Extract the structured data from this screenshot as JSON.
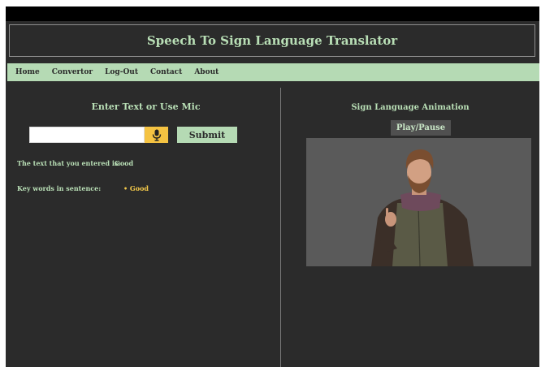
{
  "header": {
    "title": "Speech To Sign Language Translator"
  },
  "nav": {
    "items": [
      "Home",
      "Convertor",
      "Log-Out",
      "Contact",
      "About"
    ]
  },
  "left": {
    "title": "Enter Text or Use Mic",
    "input": {
      "value": "",
      "placeholder": ""
    },
    "mic_icon": "microphone-icon",
    "submit_label": "Submit",
    "entered_label": "The text that you entered is:",
    "entered_value": "Good",
    "keywords_label": "Key words in sentence:",
    "keywords": [
      "Good"
    ]
  },
  "right": {
    "title": "Sign Language Animation",
    "play_label": "Play/Pause"
  },
  "colors": {
    "background": "#2b2b2b",
    "accent_green": "#b5dab4",
    "header_text": "#b9dfb6",
    "keyword_yellow": "#f3c94a",
    "mic_button": "#f5c342",
    "video_bg": "#5a5a5a"
  }
}
